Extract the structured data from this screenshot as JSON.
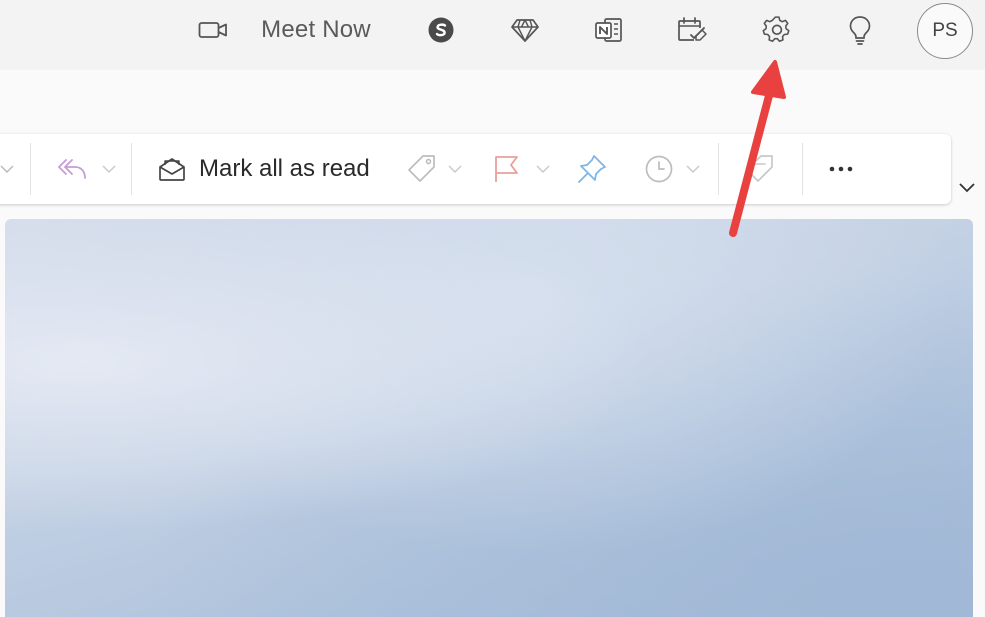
{
  "topbar": {
    "meet_now_label": "Meet Now",
    "avatar_initials": "PS",
    "icons": [
      "video-camera-icon",
      "skype-icon",
      "diamond-icon",
      "onenote-icon",
      "calendar-check-icon",
      "gear-icon",
      "lightbulb-icon"
    ]
  },
  "commandbar": {
    "mark_all_read_label": "Mark all as read",
    "icons": [
      "reply-all-icon",
      "envelope-open-icon",
      "tag-icon",
      "flag-icon",
      "pin-icon",
      "clock-icon",
      "tag-outline-icon",
      "more-icon"
    ]
  },
  "colors": {
    "annotation_arrow": "#e8413f",
    "flag_accent": "#e8a09a",
    "pin_accent": "#7fb6e6",
    "reply_accent": "#c79bd8"
  }
}
